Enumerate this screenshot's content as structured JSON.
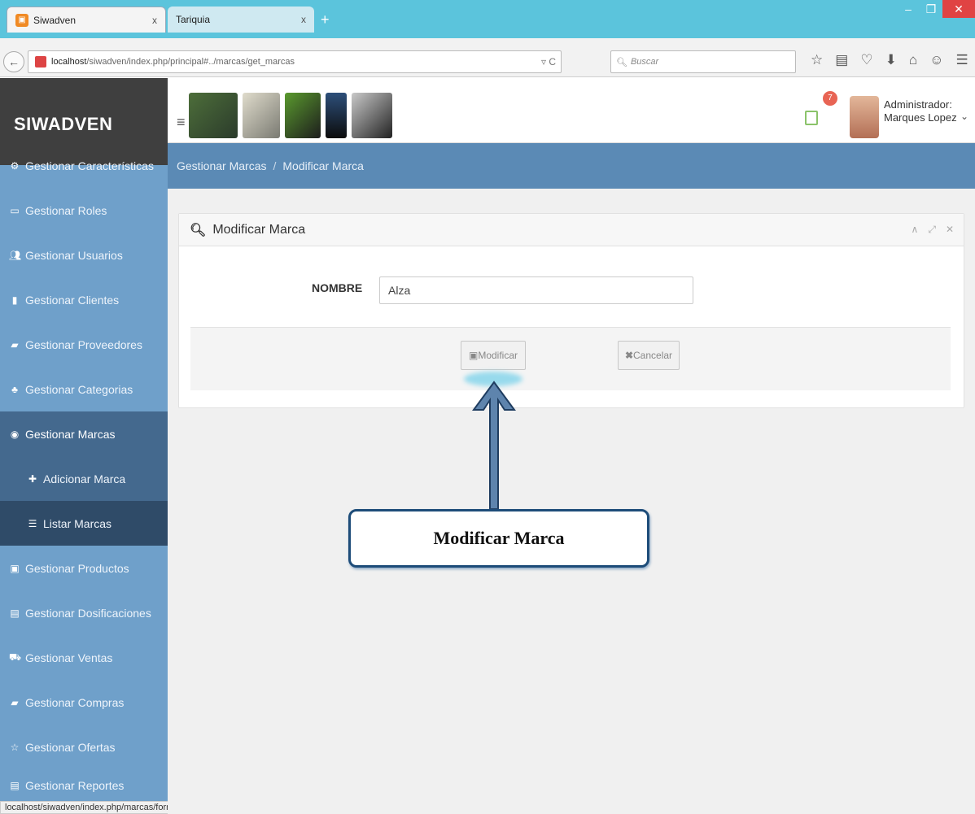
{
  "browser": {
    "tabs": [
      {
        "label": "Siwadven",
        "close": "x"
      },
      {
        "label": "Tariquia",
        "close": "x"
      }
    ],
    "newtab": "+",
    "url_host": "localhost",
    "url_path": "/siwadven/index.php/principal#../marcas/get_marcas",
    "search_placeholder": "Buscar",
    "status_url": "localhost/siwadven/index.php/marcas/formulario?codigo_marca=3"
  },
  "app": {
    "brand": "SIWADVEN",
    "notifications_count": "7",
    "user_role": "Administrador:",
    "user_name": "Marques Lopez"
  },
  "sidebar": {
    "items": [
      {
        "label": "Gestionar Características",
        "icon": "gears-icon"
      },
      {
        "label": "Gestionar Roles",
        "icon": "id-card-icon"
      },
      {
        "label": "Gestionar Usuarios",
        "icon": "users-icon"
      },
      {
        "label": "Gestionar Clientes",
        "icon": "briefcase-icon"
      },
      {
        "label": "Gestionar Proveedores",
        "icon": "truck-icon"
      },
      {
        "label": "Gestionar Categorias",
        "icon": "sitemap-icon"
      },
      {
        "label": "Gestionar Marcas",
        "icon": "target-icon"
      },
      {
        "label": "Adicionar Marca",
        "icon": "plus-icon"
      },
      {
        "label": "Listar Marcas",
        "icon": "list-icon"
      },
      {
        "label": "Gestionar Productos",
        "icon": "box-icon"
      },
      {
        "label": "Gestionar Dosificaciones",
        "icon": "document-icon"
      },
      {
        "label": "Gestionar Ventas",
        "icon": "cart-icon"
      },
      {
        "label": "Gestionar Compras",
        "icon": "book-icon"
      },
      {
        "label": "Gestionar Ofertas",
        "icon": "star-icon"
      },
      {
        "label": "Gestionar Reportes",
        "icon": "report-icon"
      }
    ]
  },
  "breadcrumb": {
    "parent": "Gestionar Marcas",
    "separator": "/",
    "current": "Modificar Marca"
  },
  "panel": {
    "title": "Modificar Marca",
    "field_label": "NOMBRE",
    "field_value": "Alza",
    "modify_label": "Modificar",
    "cancel_label": "Cancelar"
  },
  "annotation": {
    "text": "Modificar Marca"
  },
  "colors": {
    "sidebar": "#6fa0ca",
    "sidebar_active": "#44698e",
    "breadcrumb": "#5b8ab5",
    "annotation_border": "#1d4c79"
  }
}
